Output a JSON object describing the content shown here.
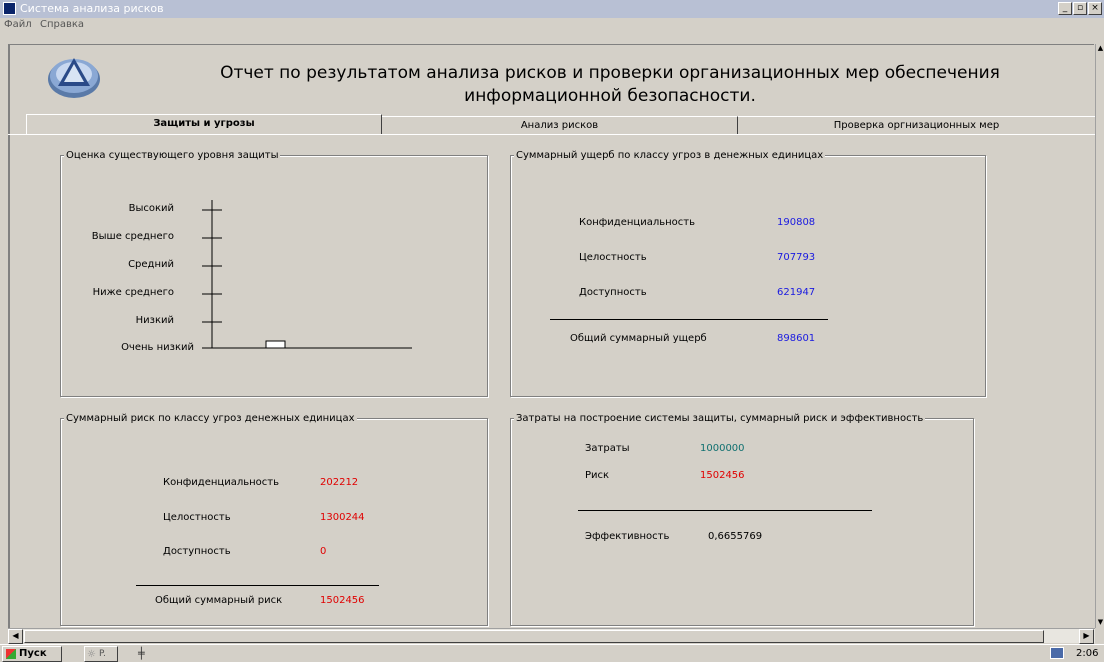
{
  "window": {
    "title": "Система анализа рисков",
    "buttons": [
      "_",
      "▫",
      "×"
    ]
  },
  "menu": [
    "Файл",
    "Справка"
  ],
  "header": {
    "title_line1": "Отчет по результатом анализа рисков и проверки организационных мер обеспечения",
    "title_line2": "информационной безопасности."
  },
  "tabs": [
    "Защиты и угрозы",
    "Анализ рисков",
    "Проверка оргнизационных мер"
  ],
  "protection": {
    "title": "Оценка существующего уровня защиты",
    "levels": [
      "Высокий",
      "Выше среднего",
      "Средний",
      "Ниже среднего",
      "Низкий",
      "Очень низкий"
    ],
    "current_level": "Очень низкий"
  },
  "damage": {
    "title": "Суммарный ущерб по классу угроз в денежных единицах",
    "rows": [
      {
        "label": "Конфиденциальность",
        "value": "190808"
      },
      {
        "label": "Целостность",
        "value": "707793"
      },
      {
        "label": "Доступность",
        "value": "621947"
      }
    ],
    "total_label": "Общий суммарный ущерб",
    "total_value": "898601"
  },
  "risk": {
    "title": "Суммарный риск по  классу угроз денежных единицах",
    "rows": [
      {
        "label": "Конфиденциальность",
        "value": "202212"
      },
      {
        "label": "Целостность",
        "value": "1300244"
      },
      {
        "label": "Доступность",
        "value": "0"
      }
    ],
    "total_label": "Общий суммарный риск",
    "total_value": "1502456"
  },
  "costs": {
    "title": "Затраты на построение системы защиты, суммарный риск и эффективность",
    "cost_label": "Затраты",
    "cost_value": "1000000",
    "risk_label": "Риск",
    "risk_value": "1502456",
    "eff_label": "Эффективность",
    "eff_value": "0,6655769"
  },
  "taskbar": {
    "start": "Пуск",
    "task": "P.",
    "clock": "2:06"
  },
  "colors": {
    "titlebar": "#b8c0d4",
    "face": "#d4d0c8",
    "blue_value": "#1a1ae0",
    "red_value": "#e00000",
    "teal_value": "#107070"
  }
}
